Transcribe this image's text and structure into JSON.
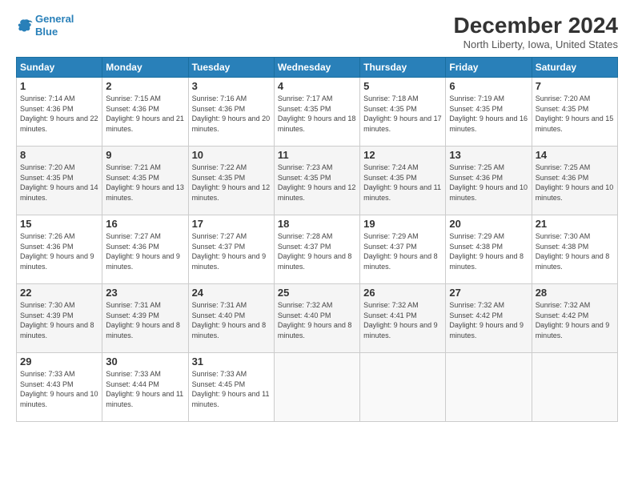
{
  "logo": {
    "line1": "General",
    "line2": "Blue"
  },
  "title": "December 2024",
  "location": "North Liberty, Iowa, United States",
  "days_of_week": [
    "Sunday",
    "Monday",
    "Tuesday",
    "Wednesday",
    "Thursday",
    "Friday",
    "Saturday"
  ],
  "weeks": [
    [
      {
        "day": "1",
        "sunrise": "7:14 AM",
        "sunset": "4:36 PM",
        "daylight": "9 hours and 22 minutes."
      },
      {
        "day": "2",
        "sunrise": "7:15 AM",
        "sunset": "4:36 PM",
        "daylight": "9 hours and 21 minutes."
      },
      {
        "day": "3",
        "sunrise": "7:16 AM",
        "sunset": "4:36 PM",
        "daylight": "9 hours and 20 minutes."
      },
      {
        "day": "4",
        "sunrise": "7:17 AM",
        "sunset": "4:35 PM",
        "daylight": "9 hours and 18 minutes."
      },
      {
        "day": "5",
        "sunrise": "7:18 AM",
        "sunset": "4:35 PM",
        "daylight": "9 hours and 17 minutes."
      },
      {
        "day": "6",
        "sunrise": "7:19 AM",
        "sunset": "4:35 PM",
        "daylight": "9 hours and 16 minutes."
      },
      {
        "day": "7",
        "sunrise": "7:20 AM",
        "sunset": "4:35 PM",
        "daylight": "9 hours and 15 minutes."
      }
    ],
    [
      {
        "day": "8",
        "sunrise": "7:20 AM",
        "sunset": "4:35 PM",
        "daylight": "9 hours and 14 minutes."
      },
      {
        "day": "9",
        "sunrise": "7:21 AM",
        "sunset": "4:35 PM",
        "daylight": "9 hours and 13 minutes."
      },
      {
        "day": "10",
        "sunrise": "7:22 AM",
        "sunset": "4:35 PM",
        "daylight": "9 hours and 12 minutes."
      },
      {
        "day": "11",
        "sunrise": "7:23 AM",
        "sunset": "4:35 PM",
        "daylight": "9 hours and 12 minutes."
      },
      {
        "day": "12",
        "sunrise": "7:24 AM",
        "sunset": "4:35 PM",
        "daylight": "9 hours and 11 minutes."
      },
      {
        "day": "13",
        "sunrise": "7:25 AM",
        "sunset": "4:36 PM",
        "daylight": "9 hours and 10 minutes."
      },
      {
        "day": "14",
        "sunrise": "7:25 AM",
        "sunset": "4:36 PM",
        "daylight": "9 hours and 10 minutes."
      }
    ],
    [
      {
        "day": "15",
        "sunrise": "7:26 AM",
        "sunset": "4:36 PM",
        "daylight": "9 hours and 9 minutes."
      },
      {
        "day": "16",
        "sunrise": "7:27 AM",
        "sunset": "4:36 PM",
        "daylight": "9 hours and 9 minutes."
      },
      {
        "day": "17",
        "sunrise": "7:27 AM",
        "sunset": "4:37 PM",
        "daylight": "9 hours and 9 minutes."
      },
      {
        "day": "18",
        "sunrise": "7:28 AM",
        "sunset": "4:37 PM",
        "daylight": "9 hours and 8 minutes."
      },
      {
        "day": "19",
        "sunrise": "7:29 AM",
        "sunset": "4:37 PM",
        "daylight": "9 hours and 8 minutes."
      },
      {
        "day": "20",
        "sunrise": "7:29 AM",
        "sunset": "4:38 PM",
        "daylight": "9 hours and 8 minutes."
      },
      {
        "day": "21",
        "sunrise": "7:30 AM",
        "sunset": "4:38 PM",
        "daylight": "9 hours and 8 minutes."
      }
    ],
    [
      {
        "day": "22",
        "sunrise": "7:30 AM",
        "sunset": "4:39 PM",
        "daylight": "9 hours and 8 minutes."
      },
      {
        "day": "23",
        "sunrise": "7:31 AM",
        "sunset": "4:39 PM",
        "daylight": "9 hours and 8 minutes."
      },
      {
        "day": "24",
        "sunrise": "7:31 AM",
        "sunset": "4:40 PM",
        "daylight": "9 hours and 8 minutes."
      },
      {
        "day": "25",
        "sunrise": "7:32 AM",
        "sunset": "4:40 PM",
        "daylight": "9 hours and 8 minutes."
      },
      {
        "day": "26",
        "sunrise": "7:32 AM",
        "sunset": "4:41 PM",
        "daylight": "9 hours and 9 minutes."
      },
      {
        "day": "27",
        "sunrise": "7:32 AM",
        "sunset": "4:42 PM",
        "daylight": "9 hours and 9 minutes."
      },
      {
        "day": "28",
        "sunrise": "7:32 AM",
        "sunset": "4:42 PM",
        "daylight": "9 hours and 9 minutes."
      }
    ],
    [
      {
        "day": "29",
        "sunrise": "7:33 AM",
        "sunset": "4:43 PM",
        "daylight": "9 hours and 10 minutes."
      },
      {
        "day": "30",
        "sunrise": "7:33 AM",
        "sunset": "4:44 PM",
        "daylight": "9 hours and 11 minutes."
      },
      {
        "day": "31",
        "sunrise": "7:33 AM",
        "sunset": "4:45 PM",
        "daylight": "9 hours and 11 minutes."
      },
      null,
      null,
      null,
      null
    ]
  ],
  "labels": {
    "sunrise": "Sunrise:",
    "sunset": "Sunset:",
    "daylight": "Daylight:"
  }
}
